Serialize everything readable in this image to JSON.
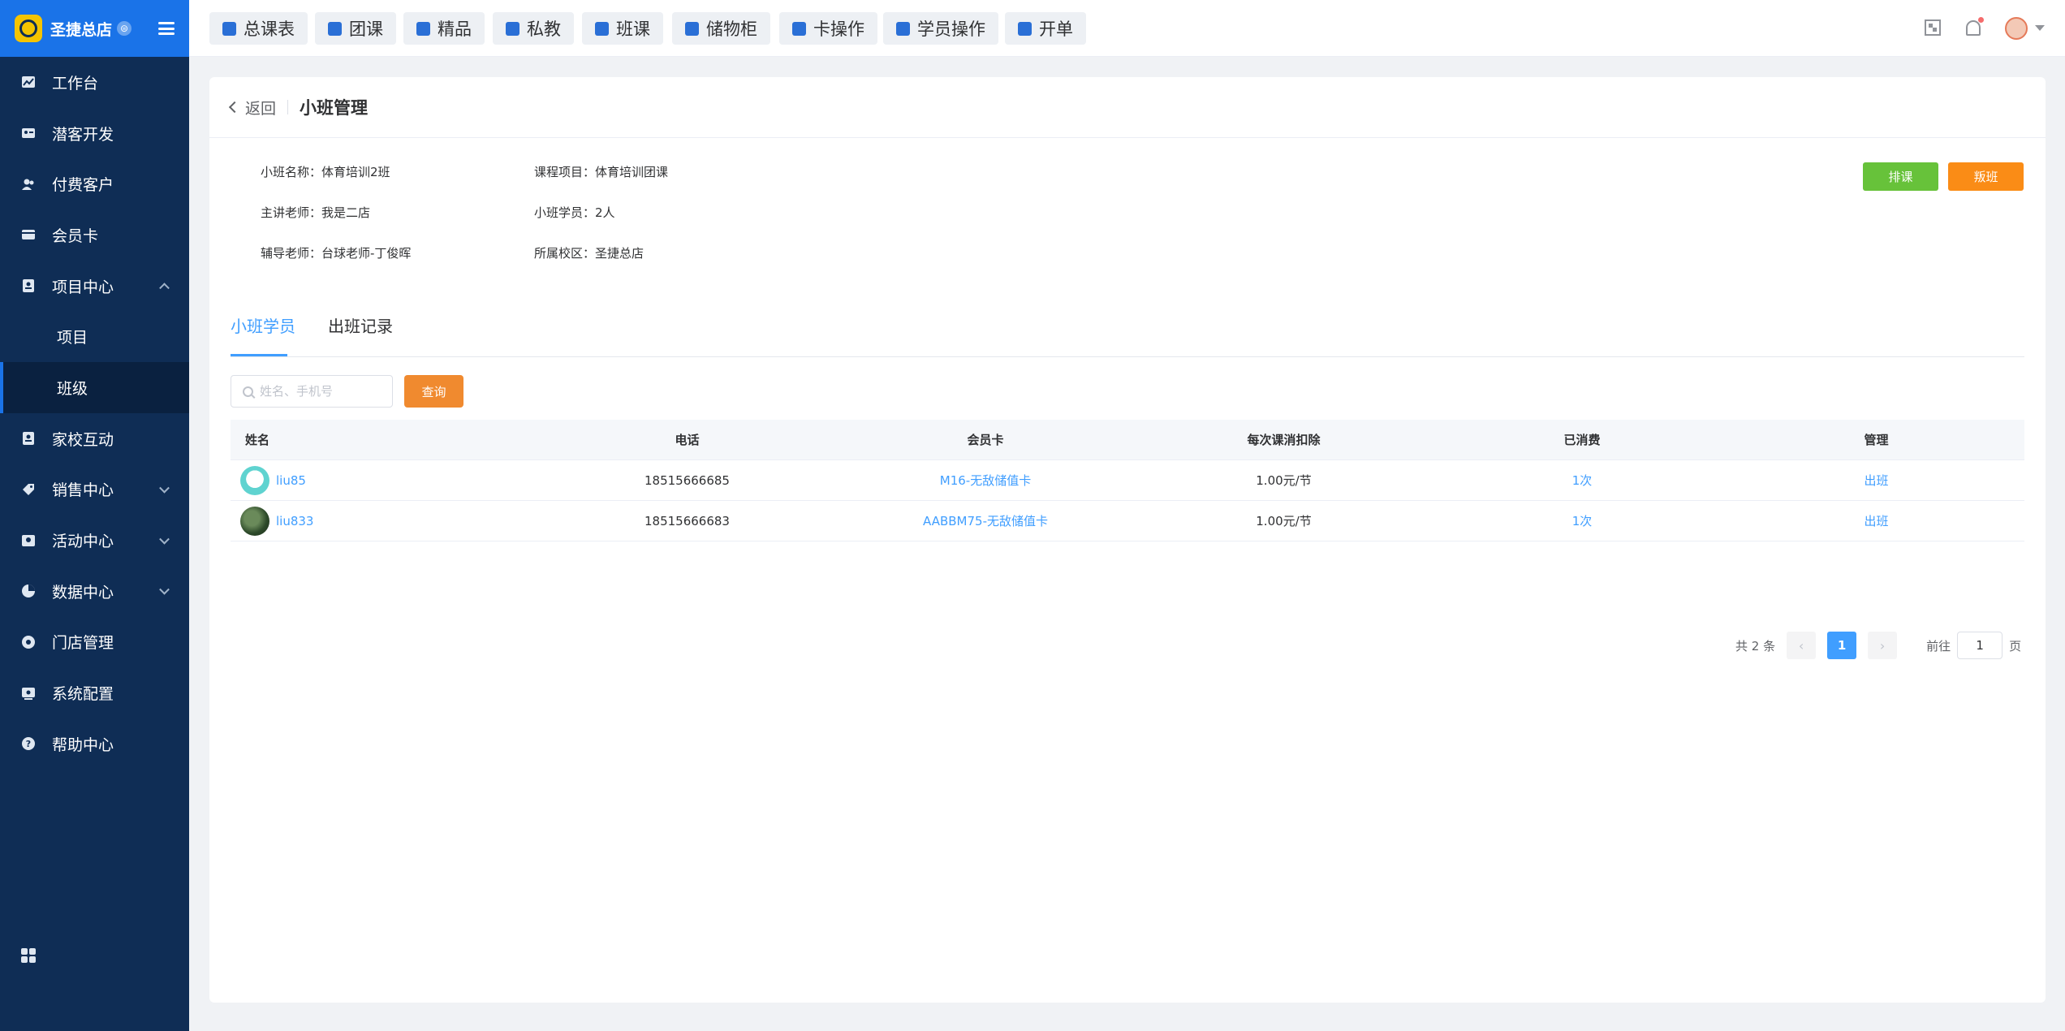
{
  "brand": {
    "name": "圣捷总店",
    "badge": "⊜"
  },
  "sidebar": {
    "items": [
      {
        "label": "工作台",
        "icon": "dashboard-icon"
      },
      {
        "label": "潜客开发",
        "icon": "id-card-icon"
      },
      {
        "label": "付费客户",
        "icon": "users-icon"
      },
      {
        "label": "会员卡",
        "icon": "card-icon"
      },
      {
        "label": "项目中心",
        "icon": "project-icon",
        "expanded": true
      },
      {
        "label": "项目",
        "sub": true
      },
      {
        "label": "班级",
        "sub": true,
        "active": true
      },
      {
        "label": "家校互动",
        "icon": "interaction-icon"
      },
      {
        "label": "销售中心",
        "icon": "tag-icon",
        "has_children": true
      },
      {
        "label": "活动中心",
        "icon": "activity-icon",
        "has_children": true
      },
      {
        "label": "数据中心",
        "icon": "pie-chart-icon",
        "has_children": true
      },
      {
        "label": "门店管理",
        "icon": "store-icon"
      },
      {
        "label": "系统配置",
        "icon": "settings-icon"
      },
      {
        "label": "帮助中心",
        "icon": "help-icon"
      }
    ]
  },
  "topnav": {
    "tabs": [
      "总课表",
      "团课",
      "精品",
      "私教",
      "班课",
      "储物柜",
      "卡操作",
      "学员操作",
      "开单"
    ]
  },
  "header": {
    "back_label": "返回",
    "title": "小班管理"
  },
  "info": {
    "class_name": "小班名称：体育培训2班",
    "course": "课程项目：体育培训团课",
    "teacher": "主讲老师：我是二店",
    "students": "小班学员：2人",
    "assistant": "辅导老师：台球老师-丁俊晖",
    "campus": "所属校区：圣捷总店"
  },
  "actions": {
    "schedule_label": "排课",
    "exit_label": "叛班"
  },
  "tabs": {
    "students_label": "小班学员",
    "records_label": "出班记录"
  },
  "search": {
    "placeholder": "姓名、手机号",
    "button_label": "查询"
  },
  "table": {
    "columns": [
      "姓名",
      "电话",
      "会员卡",
      "每次课消扣除",
      "已消费",
      "管理"
    ],
    "rows": [
      {
        "name": "liu85",
        "phone": "18515666685",
        "card": "M16-无敌储值卡",
        "deduct": "1.00元/节",
        "consumed": "1次",
        "action": "出班"
      },
      {
        "name": "liu833",
        "phone": "18515666683",
        "card": "AABBM75-无敌储值卡",
        "deduct": "1.00元/节",
        "consumed": "1次",
        "action": "出班"
      }
    ]
  },
  "pagination": {
    "total_label": "共 2 条",
    "current_page": "1",
    "goto_label": "前往",
    "goto_value": "1",
    "page_suffix": "页"
  },
  "colors": {
    "sidebar_bg": "#0f2d55",
    "brand_bg": "#1a73e8",
    "accent": "#409eff",
    "schedule_btn": "#67c23a",
    "exit_btn": "#fa8c16",
    "query_btn": "#f08a2f"
  }
}
